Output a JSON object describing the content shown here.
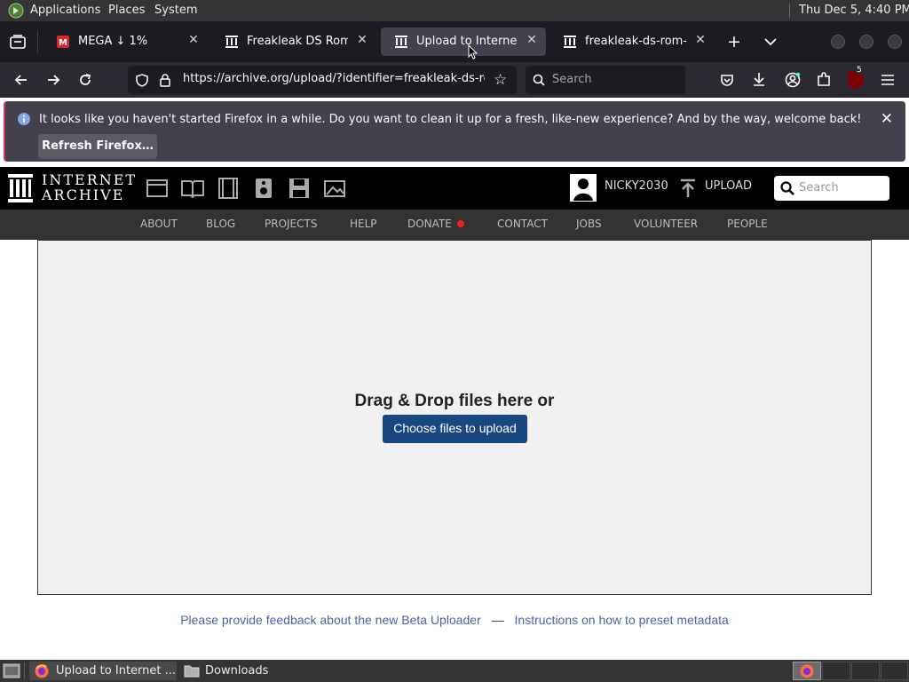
{
  "desktop": {
    "menus": [
      "Applications",
      "Places",
      "System"
    ],
    "clock": "Thu Dec  5,  4:40 PM"
  },
  "browser": {
    "tabs": [
      {
        "label": "MEGA ↓ 1%",
        "icon": "mega-icon",
        "active": false
      },
      {
        "label": "Freakleak DS Rom Col",
        "icon": "archive-icon",
        "active": false
      },
      {
        "label": "Upload to Internet Ar",
        "icon": "archive-icon",
        "active": true
      },
      {
        "label": "freakleak-ds-rom-coll",
        "icon": "archive-icon",
        "active": false
      }
    ],
    "url": "https://archive.org/upload/?identifier=freakleak-ds-rom",
    "search_placeholder": "Search",
    "extension_badge": "5"
  },
  "notification": {
    "message": "It looks like you haven't started Firefox in a while. Do you want to clean it up for a fresh, like-new experience? And by the way, welcome back!",
    "button_label": "Refresh Firefox…"
  },
  "site": {
    "logo_line1": "INTERNET",
    "logo_line2": "ARCHIVE",
    "username": "NICKY2030",
    "upload_label": "UPLOAD",
    "search_placeholder": "Search",
    "nav": [
      "ABOUT",
      "BLOG",
      "PROJECTS",
      "HELP",
      "DONATE",
      "CONTACT",
      "JOBS",
      "VOLUNTEER",
      "PEOPLE"
    ],
    "accent_color": "#194880"
  },
  "upload": {
    "prompt": "Drag & Drop files here or",
    "button_label": "Choose files to upload"
  },
  "footer": {
    "feedback_link": "Please provide feedback about the new Beta Uploader",
    "separator": "—",
    "instructions_link": "Instructions on how to preset metadata"
  },
  "taskbar": {
    "items": [
      "Upload to Internet ...",
      "Downloads"
    ]
  }
}
